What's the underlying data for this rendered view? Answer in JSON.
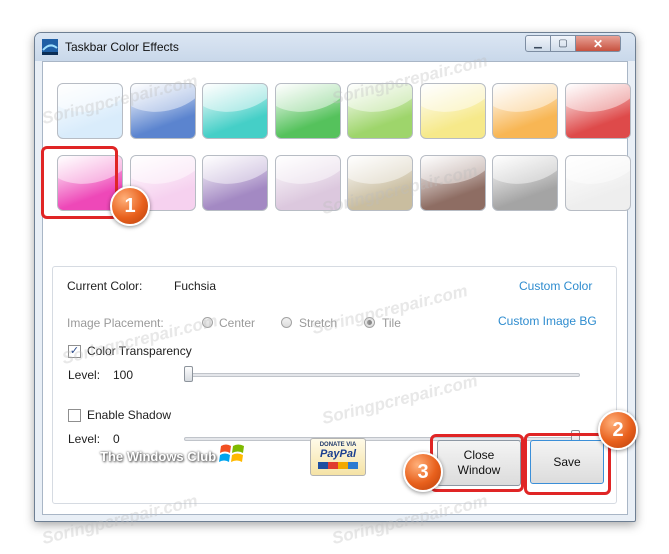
{
  "window": {
    "title": "Taskbar Color Effects",
    "min_glyph": "▁",
    "max_glyph": "▢",
    "close_glyph": "✕"
  },
  "swatches": [
    {
      "name": "swatch-light-blue",
      "color": "#d9ecfb"
    },
    {
      "name": "swatch-blue",
      "color": "#5b84cf"
    },
    {
      "name": "swatch-teal",
      "color": "#45cfc7"
    },
    {
      "name": "swatch-green",
      "color": "#55c25c"
    },
    {
      "name": "swatch-lime",
      "color": "#9ed56b"
    },
    {
      "name": "swatch-yellow",
      "color": "#f6e98a"
    },
    {
      "name": "swatch-orange",
      "color": "#f8b654"
    },
    {
      "name": "swatch-red",
      "color": "#de4a4a"
    },
    {
      "name": "swatch-fuchsia",
      "color": "#ee48b8"
    },
    {
      "name": "swatch-light-pink",
      "color": "#f6d1ef"
    },
    {
      "name": "swatch-purple",
      "color": "#a389c3"
    },
    {
      "name": "swatch-lavender",
      "color": "#dcc8de"
    },
    {
      "name": "swatch-tan",
      "color": "#c9bd9f"
    },
    {
      "name": "swatch-brown",
      "color": "#8e6d63"
    },
    {
      "name": "swatch-gray",
      "color": "#a4a4a4"
    },
    {
      "name": "swatch-white",
      "color": "#eeeeee"
    }
  ],
  "settings": {
    "current_color_label": "Current Color:",
    "current_color_value": "Fuchsia",
    "custom_color_link": "Custom Color",
    "image_placement_label": "Image Placement:",
    "placement_options": [
      "Center",
      "Stretch",
      "Tile"
    ],
    "placement_selected": "Tile",
    "custom_image_link": "Custom Image BG",
    "color_transparency_label": "Color Transparency",
    "color_transparency_checked": true,
    "transparency_level_label": "Level:",
    "transparency_level_value": "100",
    "transparency_level_fraction": 0.0,
    "enable_shadow_label": "Enable Shadow",
    "enable_shadow_checked": false,
    "shadow_level_label": "Level:",
    "shadow_level_value": "0",
    "shadow_level_fraction": 1.0
  },
  "footer": {
    "logo_text": "The Windows Club",
    "paypal_line1": "DONATE VIA",
    "paypal_line2": "PayPal",
    "close_window_label": "Close\nWindow",
    "save_label": "Save"
  },
  "annotations": {
    "badge1": "1",
    "badge2": "2",
    "badge3": "3",
    "highlight_color": "#e02525",
    "badge_color": "#e8601c"
  },
  "watermark_text": "Soringpcrepair.com"
}
